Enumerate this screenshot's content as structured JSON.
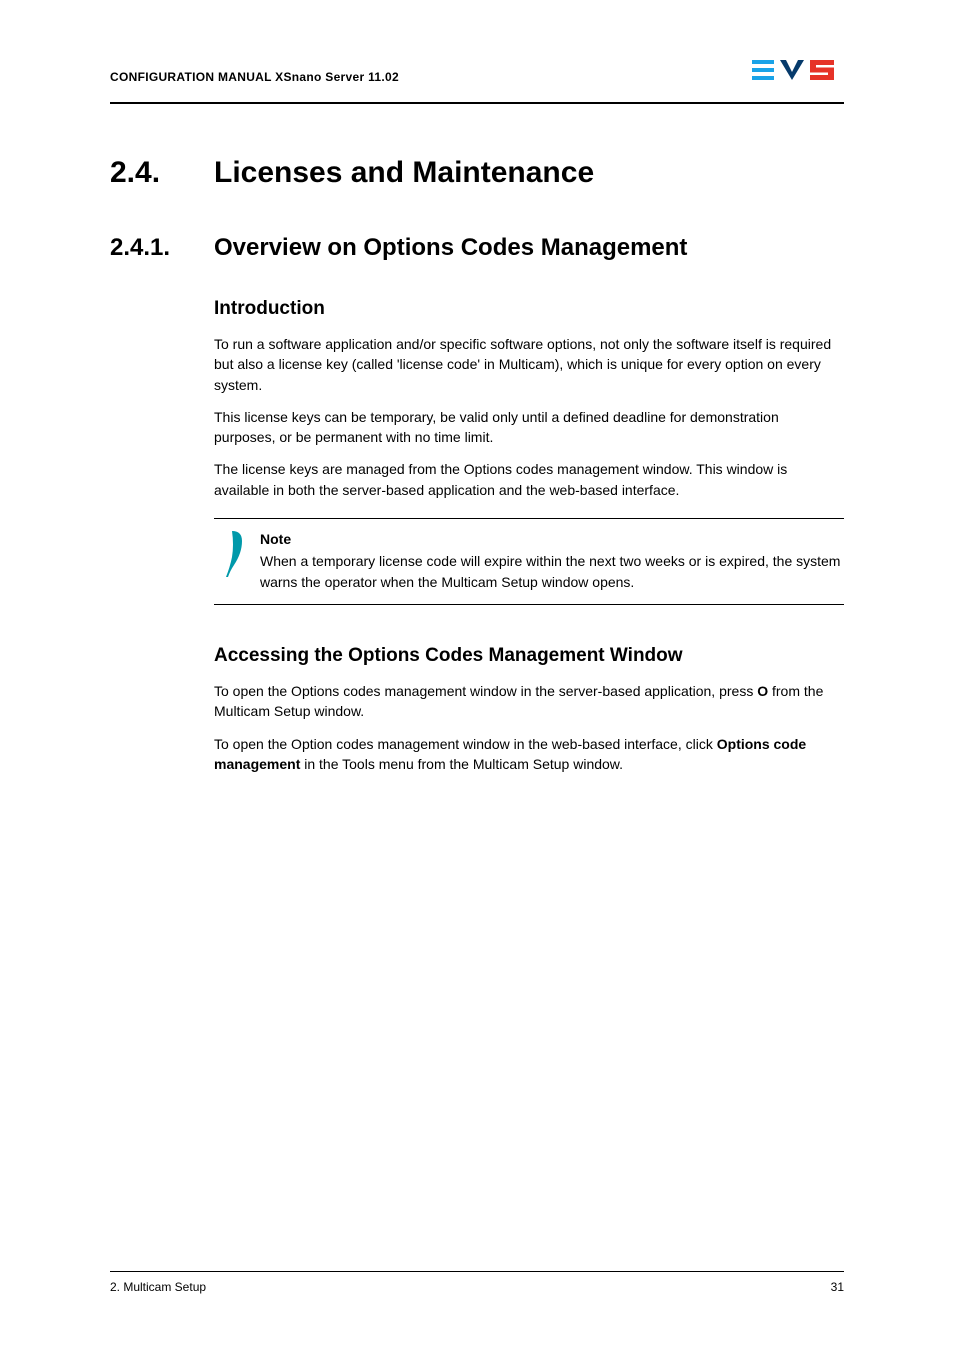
{
  "header": {
    "left": "CONFIGURATION MANUAL XSnano Server 11.02"
  },
  "section1": {
    "number": "2.4.",
    "title": "Licenses and Maintenance"
  },
  "section2": {
    "number": "2.4.1.",
    "title": "Overview on Options Codes Management"
  },
  "intro": {
    "heading": "Introduction",
    "p1": "To run a software application and/or specific software options, not only the software itself is required but also a license key (called 'license code' in Multicam), which is unique for every option on every system.",
    "p2": "This license keys can be temporary, be valid only until a defined deadline for demonstration purposes, or be permanent with no time limit.",
    "p3": "The license keys are managed from the Options codes management window. This window is available in both the server-based application and the web-based interface."
  },
  "note": {
    "title": "Note",
    "body": "When a temporary license code will expire within the next two weeks or is expired, the system warns the operator when the Multicam Setup window opens."
  },
  "access": {
    "heading": "Accessing the Options Codes Management Window",
    "p1_a": "To open the Options codes management window in the server-based application, press ",
    "p1_key": "O",
    "p1_b": " from the Multicam Setup window.",
    "p2_a": "To open the Option codes management window in the web-based interface, click ",
    "p2_key": "Options code management",
    "p2_b": " in the Tools menu from the Multicam Setup window."
  },
  "footer": {
    "left": "2. Multicam Setup",
    "right": "31"
  }
}
